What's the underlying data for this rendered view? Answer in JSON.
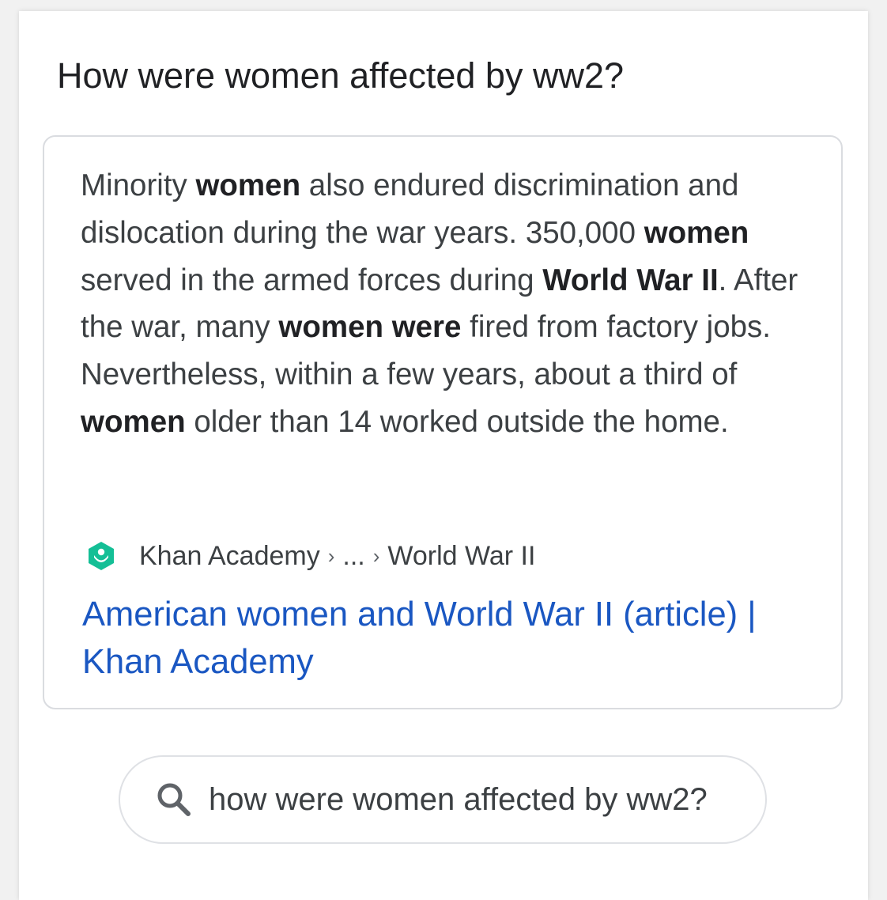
{
  "question": "How were women affected by ww2?",
  "snippet": {
    "segments": [
      {
        "text": "Minority ",
        "bold": false
      },
      {
        "text": "women",
        "bold": true
      },
      {
        "text": " also endured discrimination and dislocation during the war years. 350,000 ",
        "bold": false
      },
      {
        "text": "women",
        "bold": true
      },
      {
        "text": " served in the armed forces during ",
        "bold": false
      },
      {
        "text": "World War II",
        "bold": true
      },
      {
        "text": ". After the war, many ",
        "bold": false
      },
      {
        "text": "women were",
        "bold": true
      },
      {
        "text": " fired from factory jobs. Nevertheless, within a few years, about a third of ",
        "bold": false
      },
      {
        "text": "women",
        "bold": true
      },
      {
        "text": " older than 14 worked outside the home.",
        "bold": false
      }
    ]
  },
  "source": {
    "favicon_icon": "khan-academy-icon",
    "favicon_color": "#14bf96",
    "site": "Khan Academy",
    "separator": "›",
    "ellipsis": "...",
    "page": "World War II"
  },
  "result_title": "American women and World War II (article) | Khan Academy",
  "search_bar": {
    "icon": "search-icon",
    "query": "how were women affected by ww2?"
  },
  "colors": {
    "link": "#1a57c2",
    "text": "#3c4043",
    "border": "#dadce0"
  }
}
